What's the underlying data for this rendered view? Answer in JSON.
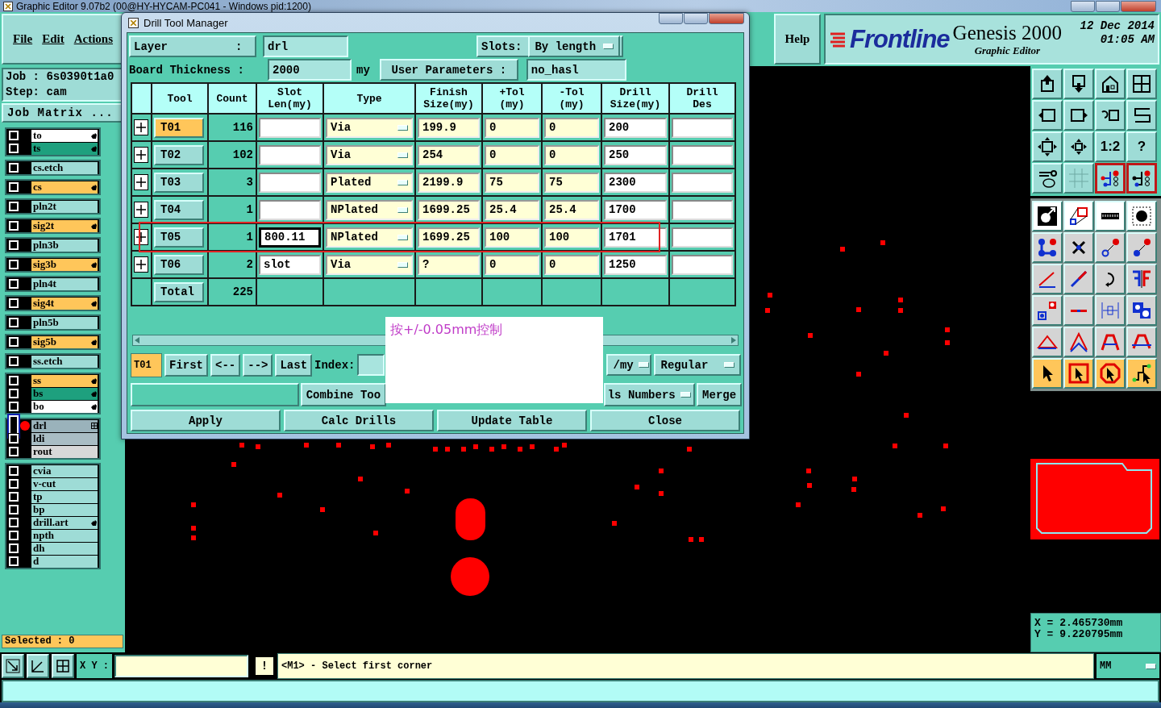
{
  "window": {
    "title": "Graphic Editor 9.07b2 (00@HY-HYCAM-PC041 - Windows  pid:1200)"
  },
  "menu": [
    "File",
    "Edit",
    "Actions"
  ],
  "help": "Help",
  "brand": {
    "logo": "Frontline",
    "product": "Genesis 2000",
    "subtitle": "Graphic Editor",
    "date": "12 Dec 2014",
    "time": "01:05 AM"
  },
  "job": {
    "job_line": "Job  :  6s0390t1a0",
    "step_line": "Step: cam",
    "matrix_button": "Job Matrix ..."
  },
  "layer_groups": [
    [
      {
        "name": "to",
        "color": "#ffffff",
        "hand": true,
        "active": false
      },
      {
        "name": "ts",
        "color": "#1ea07e",
        "hand": true,
        "active": false
      }
    ],
    [
      {
        "name": "cs.etch",
        "color": "#9edcd6",
        "hand": false,
        "active": false
      }
    ],
    [
      {
        "name": "cs",
        "color": "#ffc65a",
        "hand": true,
        "active": false
      }
    ],
    [
      {
        "name": "pln2t",
        "color": "#9edcd6",
        "hand": false,
        "active": false
      }
    ],
    [
      {
        "name": "sig2t",
        "color": "#ffc65a",
        "hand": true,
        "active": false
      }
    ],
    [
      {
        "name": "pln3b",
        "color": "#9edcd6",
        "hand": false,
        "active": false
      }
    ],
    [
      {
        "name": "sig3b",
        "color": "#ffc65a",
        "hand": true,
        "active": false
      }
    ],
    [
      {
        "name": "pln4t",
        "color": "#9edcd6",
        "hand": false,
        "active": false
      }
    ],
    [
      {
        "name": "sig4t",
        "color": "#ffc65a",
        "hand": true,
        "active": false
      }
    ],
    [
      {
        "name": "pln5b",
        "color": "#9edcd6",
        "hand": false,
        "active": false
      }
    ],
    [
      {
        "name": "sig5b",
        "color": "#ffc65a",
        "hand": true,
        "active": false
      }
    ],
    [
      {
        "name": "ss.etch",
        "color": "#9edcd6",
        "hand": false,
        "active": false
      }
    ],
    [
      {
        "name": "ss",
        "color": "#ffc65a",
        "hand": true,
        "active": false
      },
      {
        "name": "bs",
        "color": "#1ea07e",
        "hand": true,
        "active": false
      },
      {
        "name": "bo",
        "color": "#ffffff",
        "hand": true,
        "active": false
      }
    ],
    [
      {
        "name": "drl",
        "color": "#9ab2bb",
        "hand": false,
        "active": true
      },
      {
        "name": "ldi",
        "color": "#a9bdc4",
        "hand": false,
        "active": false
      },
      {
        "name": "rout",
        "color": "#d8d8d8",
        "hand": false,
        "active": false
      }
    ],
    [
      {
        "name": "cvia",
        "color": "#9edcd6",
        "hand": false,
        "active": false
      },
      {
        "name": "v-cut",
        "color": "#9edcd6",
        "hand": false,
        "active": false
      },
      {
        "name": "tp",
        "color": "#9edcd6",
        "hand": false,
        "active": false
      },
      {
        "name": "bp",
        "color": "#9edcd6",
        "hand": false,
        "active": false
      },
      {
        "name": "drill.art",
        "color": "#9edcd6",
        "hand": true,
        "active": false
      },
      {
        "name": "npth",
        "color": "#9edcd6",
        "hand": false,
        "active": false
      },
      {
        "name": "dh",
        "color": "#9edcd6",
        "hand": false,
        "active": false
      },
      {
        "name": "d",
        "color": "#9edcd6",
        "hand": false,
        "active": false
      }
    ]
  ],
  "selected_count": "Selected : 0",
  "toolbar": {
    "scale_label": "1:2",
    "help_label": "?"
  },
  "coordinates": {
    "x": "X  = 2.465730mm",
    "y": "Y  = 9.220795mm"
  },
  "command_bar": {
    "xy_label": "X Y :",
    "alert": "!",
    "message": "<M1> - Select first corner",
    "units": "MM"
  },
  "dialog": {
    "title": "Drill Tool Manager",
    "layer_label": "Layer          :",
    "layer": "drl",
    "slots_label": "Slots:",
    "slots": "By length",
    "thickness_label": "Board Thickness :",
    "thickness": "2000",
    "thickness_unit": "my",
    "user_params_button": "User Parameters :",
    "user_params": "no_hasl",
    "columns": [
      [
        "Tool"
      ],
      [
        "Count"
      ],
      [
        "Slot",
        "Len(my)"
      ],
      [
        "Type"
      ],
      [
        "Finish",
        "Size(my)"
      ],
      [
        "+Tol",
        "(my)"
      ],
      [
        "-Tol",
        "(my)"
      ],
      [
        "Drill",
        "Size(my)"
      ],
      [
        "Drill",
        "Des"
      ]
    ],
    "rows": [
      {
        "tool": "T01",
        "selected": true,
        "count": "116",
        "type": "Via",
        "finish": "199.9",
        "plus_tol": "0",
        "minus_tol": "0",
        "drill": "200",
        "slot_len_focused": false
      },
      {
        "tool": "T02",
        "selected": false,
        "count": "102",
        "type": "Via",
        "finish": "254",
        "plus_tol": "0",
        "minus_tol": "0",
        "drill": "250",
        "slot_len_focused": false
      },
      {
        "tool": "T03",
        "selected": false,
        "count": "3",
        "type": "Plated",
        "finish": "2199.9",
        "plus_tol": "75",
        "minus_tol": "75",
        "drill": "2300",
        "slot_len_focused": false
      },
      {
        "tool": "T04",
        "selected": false,
        "count": "1",
        "type": "NPlated",
        "finish": "1699.25",
        "plus_tol": "25.4",
        "minus_tol": "25.4",
        "drill": "1700",
        "slot_len_focused": false
      },
      {
        "tool": "T05",
        "selected": false,
        "count": "1",
        "slot_len": "800.11",
        "type": "NPlated",
        "finish": "1699.25",
        "plus_tol": "100",
        "minus_tol": "100",
        "drill": "1701",
        "slot_len_focused": true
      },
      {
        "tool": "T06",
        "selected": false,
        "count": "2",
        "slot_len": "slot",
        "type": "Via",
        "finish": "?",
        "plus_tol": "0",
        "minus_tol": "0",
        "drill": "1250",
        "slot_len_focused": false
      }
    ],
    "total": {
      "label": "Total",
      "count": "225"
    },
    "nav": {
      "current": "T01",
      "buttons": [
        "First",
        "<--",
        "-->",
        "Last"
      ],
      "index_label": "Index:",
      "unit_menu": "/my",
      "mode_menu": "Regular"
    },
    "combine_button": "Combine Too",
    "numbers_menu": "ls Numbers",
    "merge_button": "Merge",
    "actions": [
      "Apply",
      "Calc Drills",
      "Update Table",
      "Close"
    ]
  },
  "note": {
    "text": "按+/-0.05mm控制"
  }
}
